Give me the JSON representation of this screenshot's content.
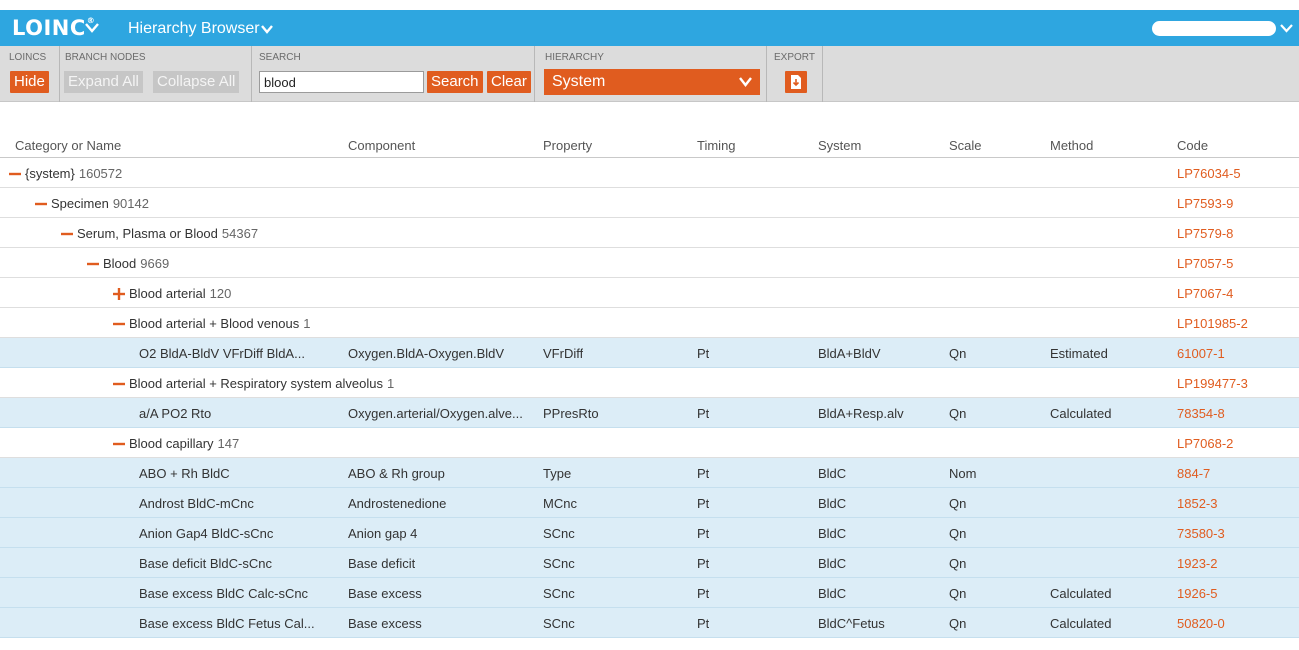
{
  "header": {
    "logo": "LOINC",
    "logo_mark": "®",
    "app_title": "Hierarchy Browser"
  },
  "toolbar": {
    "loincs": {
      "label": "LOINCS",
      "hide_button": "Hide"
    },
    "branch_nodes": {
      "label": "BRANCH NODES",
      "expand_all": "Expand All",
      "collapse_all": "Collapse All"
    },
    "search": {
      "label": "SEARCH",
      "value": "blood",
      "search_button": "Search",
      "clear_button": "Clear"
    },
    "hierarchy": {
      "label": "HIERARCHY",
      "selected": "System"
    },
    "export": {
      "label": "EXPORT",
      "icon": "export-file-icon"
    }
  },
  "colors": {
    "brand_blue": "#2ea6e0",
    "accent_orange": "#e05c1f",
    "leaf_row_bg": "#dcedf7"
  },
  "table": {
    "columns": [
      "Category or Name",
      "Component",
      "Property",
      "Timing",
      "System",
      "Scale",
      "Method",
      "Code"
    ],
    "rows": [
      {
        "level": 0,
        "toggle": "minus",
        "name": "{system}",
        "count": "160572",
        "code": "LP76034-5"
      },
      {
        "level": 1,
        "toggle": "minus",
        "name": "Specimen",
        "count": "90142",
        "code": "LP7593-9"
      },
      {
        "level": 2,
        "toggle": "minus",
        "name": "Serum, Plasma or Blood",
        "count": "54367",
        "code": "LP7579-8"
      },
      {
        "level": 3,
        "toggle": "minus",
        "name": "Blood",
        "count": "9669",
        "code": "LP7057-5"
      },
      {
        "level": 4,
        "toggle": "plus",
        "name": "Blood arterial",
        "count": "120",
        "code": "LP7067-4"
      },
      {
        "level": 4,
        "toggle": "minus",
        "name": "Blood arterial + Blood venous",
        "count": "1",
        "code": "LP101985-2"
      },
      {
        "level": 5,
        "toggle": "none",
        "name": "O2 BldA-BldV VFrDiff BldA...",
        "component": "Oxygen.BldA-Oxygen.BldV",
        "property": "VFrDiff",
        "timing": "Pt",
        "system": "BldA+BldV",
        "scale": "Qn",
        "method": "Estimated",
        "code": "61007-1"
      },
      {
        "level": 4,
        "toggle": "minus",
        "name": "Blood arterial + Respiratory system alveolus",
        "count": "1",
        "code": "LP199477-3"
      },
      {
        "level": 5,
        "toggle": "none",
        "name": "a/A PO2 Rto",
        "component": "Oxygen.arterial/Oxygen.alve...",
        "property": "PPresRto",
        "timing": "Pt",
        "system": "BldA+Resp.alv",
        "scale": "Qn",
        "method": "Calculated",
        "code": "78354-8"
      },
      {
        "level": 4,
        "toggle": "minus",
        "name": "Blood capillary",
        "count": "147",
        "code": "LP7068-2"
      },
      {
        "level": 5,
        "toggle": "none",
        "name": "ABO + Rh BldC",
        "component": "ABO & Rh group",
        "property": "Type",
        "timing": "Pt",
        "system": "BldC",
        "scale": "Nom",
        "method": "",
        "code": "884-7"
      },
      {
        "level": 5,
        "toggle": "none",
        "name": "Androst BldC-mCnc",
        "component": "Androstenedione",
        "property": "MCnc",
        "timing": "Pt",
        "system": "BldC",
        "scale": "Qn",
        "method": "",
        "code": "1852-3"
      },
      {
        "level": 5,
        "toggle": "none",
        "name": "Anion Gap4 BldC-sCnc",
        "component": "Anion gap 4",
        "property": "SCnc",
        "timing": "Pt",
        "system": "BldC",
        "scale": "Qn",
        "method": "",
        "code": "73580-3"
      },
      {
        "level": 5,
        "toggle": "none",
        "name": "Base deficit BldC-sCnc",
        "component": "Base deficit",
        "property": "SCnc",
        "timing": "Pt",
        "system": "BldC",
        "scale": "Qn",
        "method": "",
        "code": "1923-2"
      },
      {
        "level": 5,
        "toggle": "none",
        "name": "Base excess BldC Calc-sCnc",
        "component": "Base excess",
        "property": "SCnc",
        "timing": "Pt",
        "system": "BldC",
        "scale": "Qn",
        "method": "Calculated",
        "code": "1926-5"
      },
      {
        "level": 5,
        "toggle": "none",
        "name": "Base excess BldC Fetus Cal...",
        "component": "Base excess",
        "property": "SCnc",
        "timing": "Pt",
        "system": "BldC^Fetus",
        "scale": "Qn",
        "method": "Calculated",
        "code": "50820-0"
      }
    ]
  }
}
